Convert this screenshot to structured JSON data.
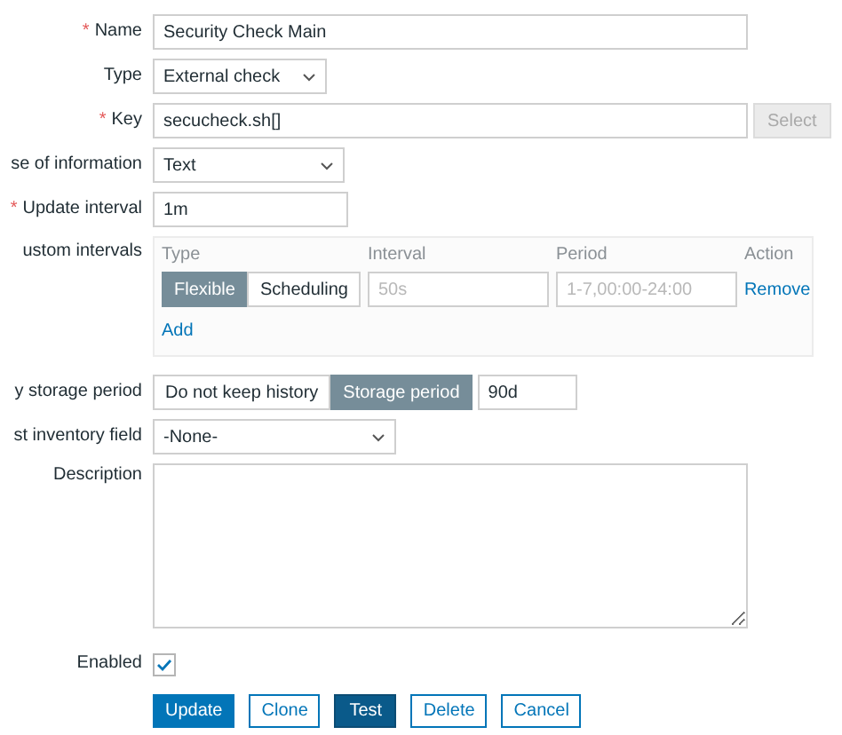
{
  "fields": [
    {
      "kind": "input",
      "label": "Name",
      "marker": "*",
      "value": "Security Check Main"
    },
    {
      "kind": "select",
      "label": "Type",
      "value": "External check"
    },
    {
      "kind": "input-button",
      "label": "Key",
      "marker": "*",
      "value": "secucheck.sh[]",
      "button": {
        "label": "Select",
        "disabled": true
      }
    },
    {
      "kind": "select",
      "label": "se of information",
      "value": "Text"
    },
    {
      "kind": "input",
      "label": "Update interval",
      "marker": "*",
      "value": "1m"
    },
    {
      "kind": "intervals",
      "label": "ustom intervals",
      "columns": [
        "Type",
        "Interval",
        "Period",
        "Action"
      ],
      "rows": [
        {
          "options": [
            {
              "label": "Flexible",
              "selected": true
            },
            {
              "label": "Scheduling",
              "selected": false
            }
          ],
          "interval_placeholder": "50s",
          "period_placeholder": "1-7,00:00-24:00",
          "action": "Remove"
        }
      ],
      "add": "Add"
    },
    {
      "kind": "segmented",
      "label": "y storage period",
      "options": [
        {
          "label": "Do not keep history",
          "selected": false
        },
        {
          "label": "Storage period",
          "selected": true
        }
      ],
      "value": "90d"
    },
    {
      "kind": "select",
      "label": "st inventory field",
      "value": "-None-"
    },
    {
      "kind": "textarea",
      "label": "Description"
    },
    {
      "kind": "checkbox",
      "label": "Enabled",
      "checked": true
    }
  ],
  "buttons": [
    {
      "label": "Update",
      "kind": "primary"
    },
    {
      "label": "Clone",
      "kind": "outline"
    },
    {
      "label": "Test",
      "kind": "dark"
    },
    {
      "label": "Delete",
      "kind": "outline"
    },
    {
      "label": "Cancel",
      "kind": "outline"
    }
  ]
}
